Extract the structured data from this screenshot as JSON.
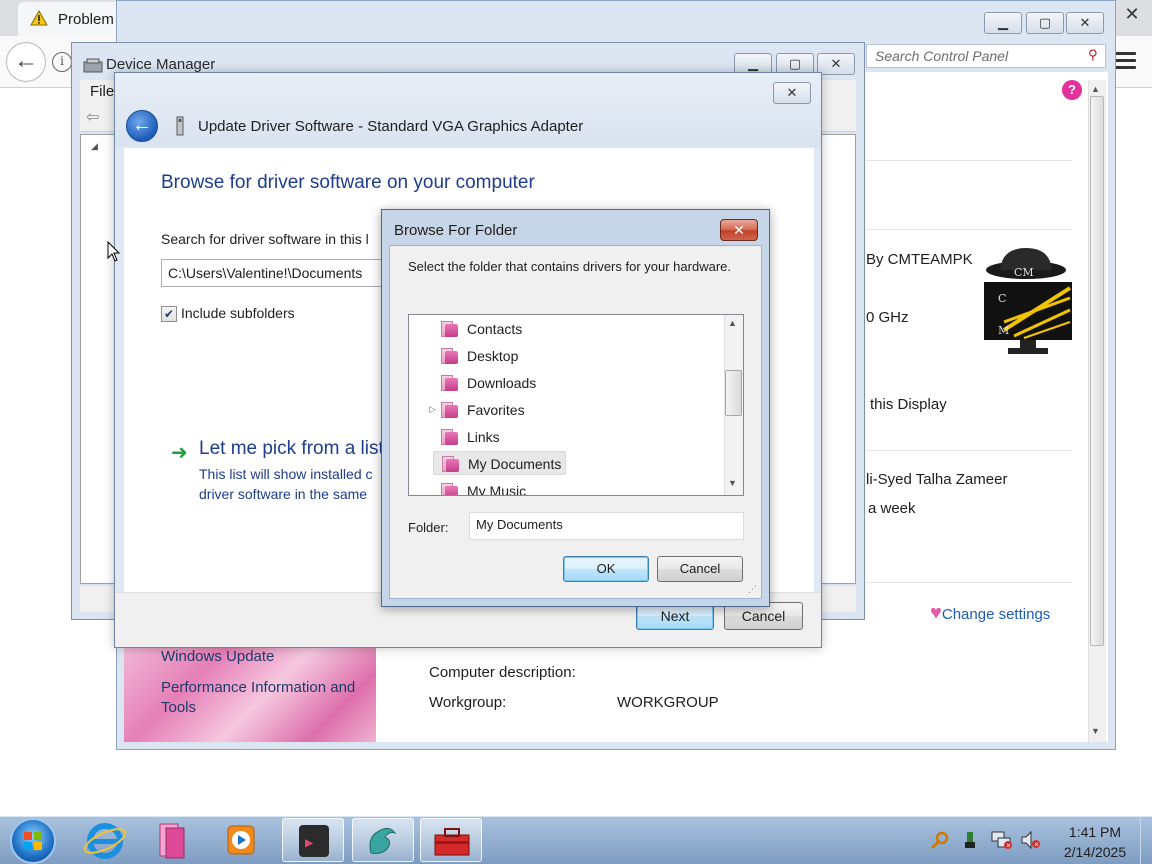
{
  "browser": {
    "tab_title": "Problem",
    "close_glyph": "✕",
    "back_glyph": "←",
    "info_glyph": "i"
  },
  "control_panel": {
    "search_placeholder": "Search Control Panel",
    "help_glyph": "?",
    "manufacturer": "By CMTEAMPK",
    "processor_suffix": "0 GHz",
    "rating_link": "this Display",
    "owner": "li-Syed Talha Zameer",
    "duration": "a week",
    "change_settings": "Change settings",
    "sidebar_links": [
      "Windows Update",
      "Performance Information and Tools"
    ],
    "computer_description_label": "Computer description:",
    "workgroup_label": "Workgroup:",
    "workgroup_value": "WORKGROUP",
    "logo_text": [
      "CM",
      "C",
      "M"
    ]
  },
  "device_manager": {
    "title": "Device Manager",
    "menu_file": "File"
  },
  "update_driver": {
    "title": "Update Driver Software - Standard VGA Graphics Adapter",
    "heading": "Browse for driver software on your computer",
    "search_label": "Search for driver software in this l",
    "path_value": "C:\\Users\\Valentine!\\Documents",
    "include_subfolders": "Include subfolders",
    "pick_title": "Let me pick from a list",
    "pick_desc_line1": "This list will show installed c",
    "pick_desc_line2": "driver software in the same",
    "next_button": "Next",
    "cancel_button": "Cancel"
  },
  "browse_folder": {
    "title": "Browse For Folder",
    "instruction": "Select the folder that contains drivers for your hardware.",
    "items": [
      "Contacts",
      "Desktop",
      "Downloads",
      "Favorites",
      "Links",
      "My Documents",
      "My Music"
    ],
    "selected": "My Documents",
    "folder_label": "Folder:",
    "folder_value": "My Documents",
    "ok_button": "OK",
    "cancel_button": "Cancel",
    "close_glyph": "✕"
  },
  "taskbar": {
    "time": "1:41 PM",
    "date": "2/14/2025",
    "apps": [
      "internet-explorer-icon",
      "folders-icon",
      "media-player-icon",
      "terminal-app-icon",
      "dragon-app-icon",
      "toolbox-app-icon"
    ],
    "tray": [
      "search-tray-icon",
      "usb-tray-icon",
      "network-tray-icon",
      "volume-muted-icon"
    ]
  },
  "colors": {
    "accent": "#1e3d8f",
    "link": "#1e5bb7",
    "taskbar": "#8fabcf"
  }
}
